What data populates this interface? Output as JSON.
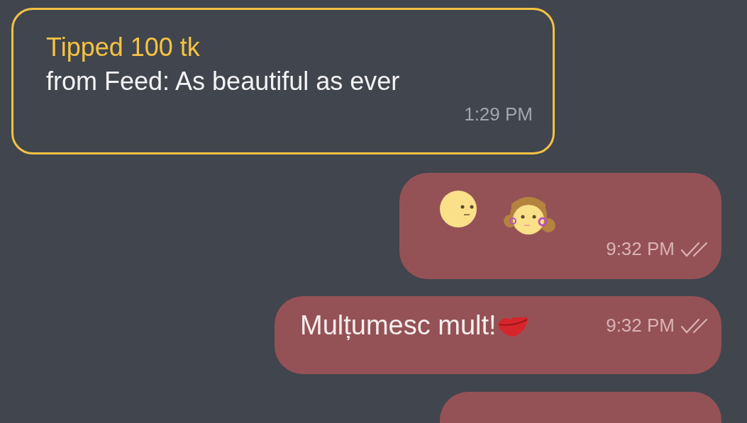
{
  "tip": {
    "title": "Tipped 100 tk",
    "text": "from Feed: As beautiful as ever",
    "time": "1:29 PM"
  },
  "messages": [
    {
      "kind": "emoji",
      "time": "9:32 PM",
      "read": true
    },
    {
      "kind": "text",
      "text": "Mulțumesc mult!",
      "time": "9:32 PM",
      "read": true
    },
    {
      "kind": "cut"
    }
  ]
}
